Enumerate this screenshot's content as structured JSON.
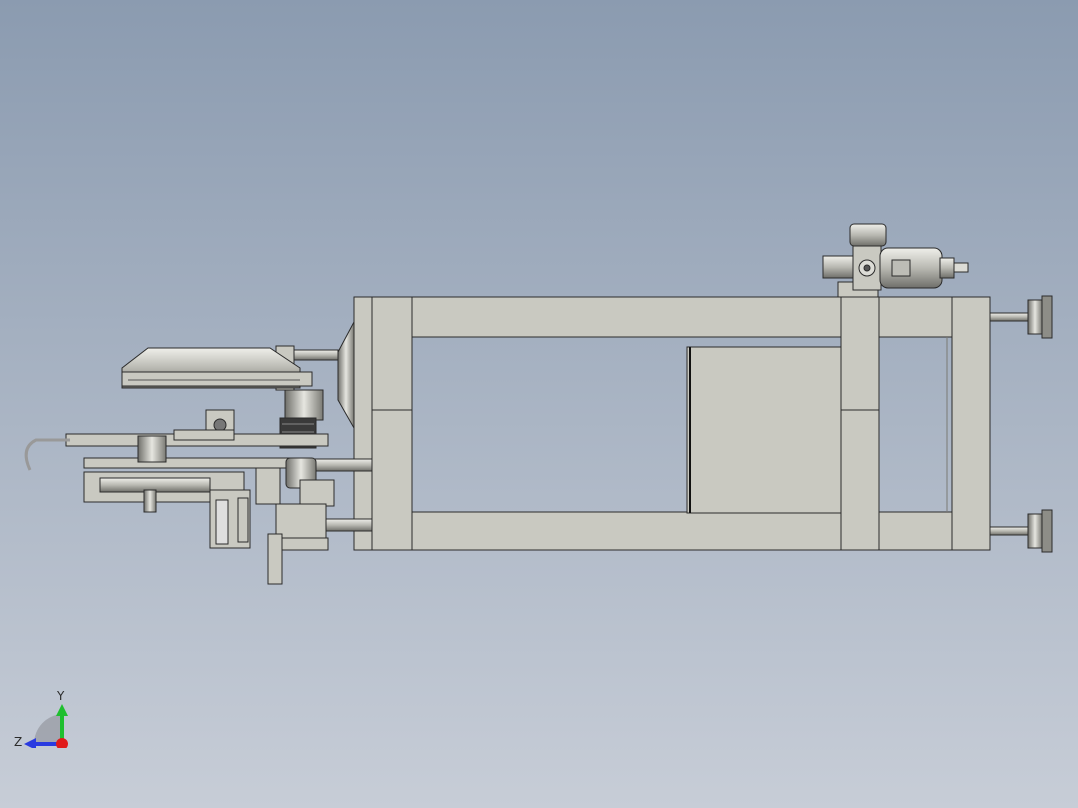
{
  "viewport": {
    "background_top": "#8b9bb0",
    "background_bottom": "#c7cdd7",
    "part_fill": "#c9c9c1",
    "edge_color": "#2b2b2b"
  },
  "triad": {
    "y_label": "Y",
    "z_label": "Z",
    "y_color": "#1fbf2f",
    "z_color": "#2a3be0",
    "x_color": "#e01a1a"
  }
}
